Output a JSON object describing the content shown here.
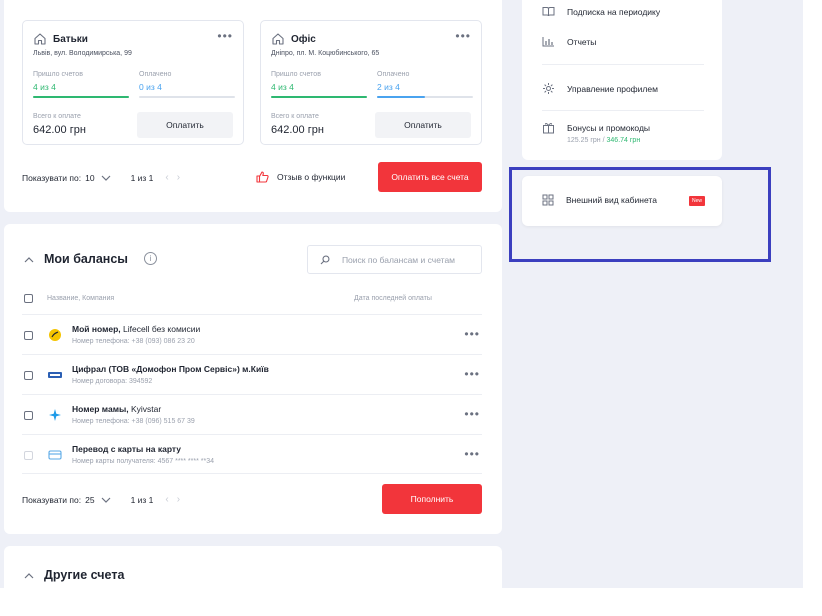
{
  "bills": [
    {
      "name": "Батьки",
      "address": "Львів, вул. Володимирська, 99",
      "came_label": "Пришло счетов",
      "came_value": "4 из 4",
      "came_progress": 1.0,
      "paid_label": "Оплачено",
      "paid_value": "0 из 4",
      "paid_progress": 0.0,
      "total_label": "Всего к оплате",
      "total": "642.00 грн",
      "pay_label": "Оплатить"
    },
    {
      "name": "Офіс",
      "address": "Дніпро, пл. М. Коцюбинського, 65",
      "came_label": "Пришло счетов",
      "came_value": "4 из 4",
      "came_progress": 1.0,
      "paid_label": "Оплачено",
      "paid_value": "2 из 4",
      "paid_progress": 0.5,
      "total_label": "Всего к оплате",
      "total": "642.00 грн",
      "pay_label": "Оплатить"
    }
  ],
  "bills_pager": {
    "show_label": "Показувати по:",
    "count": "10",
    "pages": "1 из 1"
  },
  "feedback_label": "Отзыв о функции",
  "pay_all_label": "Оплатить все счета",
  "balances": {
    "title": "Мои балансы",
    "search_placeholder": "Поиск по балансам и счетам",
    "col_name": "Название, Компания",
    "col_date": "Дата последней оплаты",
    "rows": [
      {
        "title_bold": "Мой номер,",
        "title_rest": " Lifecell без комисии",
        "sub": "Номер телефона: +38 (093) 086 23 20",
        "logo_color": "#f5c400"
      },
      {
        "title_bold": "Цифрал (ТОВ «Домофон Пром Сервіс») м.Київ",
        "title_rest": "",
        "sub": "Номер договора: 394592",
        "logo_color": "#2b5fb4"
      },
      {
        "title_bold": "Номер мамы,",
        "title_rest": " Kyivstar",
        "sub": "Номер телефона: +38 (096) 515 67 39",
        "logo_color": "#1e9be8"
      },
      {
        "title_bold": "Перевод с карты на карту",
        "title_rest": "",
        "sub": "Номер карты получателя: 4567 **** **** **34",
        "logo_color": "#5aa9e6"
      }
    ],
    "pager": {
      "show_label": "Показувати по:",
      "count": "25",
      "pages": "1 из 1"
    },
    "topup_label": "Пополнить"
  },
  "other_accounts_title": "Другие счета",
  "menu": {
    "items": [
      {
        "label": "Подписка на периодику",
        "icon": "book-icon"
      },
      {
        "label": "Отчеты",
        "icon": "chart-icon"
      },
      {
        "label": "Управление профилем",
        "icon": "gear-icon"
      },
      {
        "label": "Бонусы и промокоды",
        "icon": "gift-icon"
      }
    ],
    "bonus_amount": "125.25 грн",
    "bonus_sep": " / ",
    "bonus_extra": "346.74 грн"
  },
  "appearance": {
    "label": "Внешний вид кабинета",
    "badge": "New",
    "icon": "grid-icon"
  },
  "colors": {
    "accent_red": "#f2353b",
    "green": "#2eb871",
    "blue": "#4aa3ef",
    "highlight": "#3b3fbf"
  }
}
